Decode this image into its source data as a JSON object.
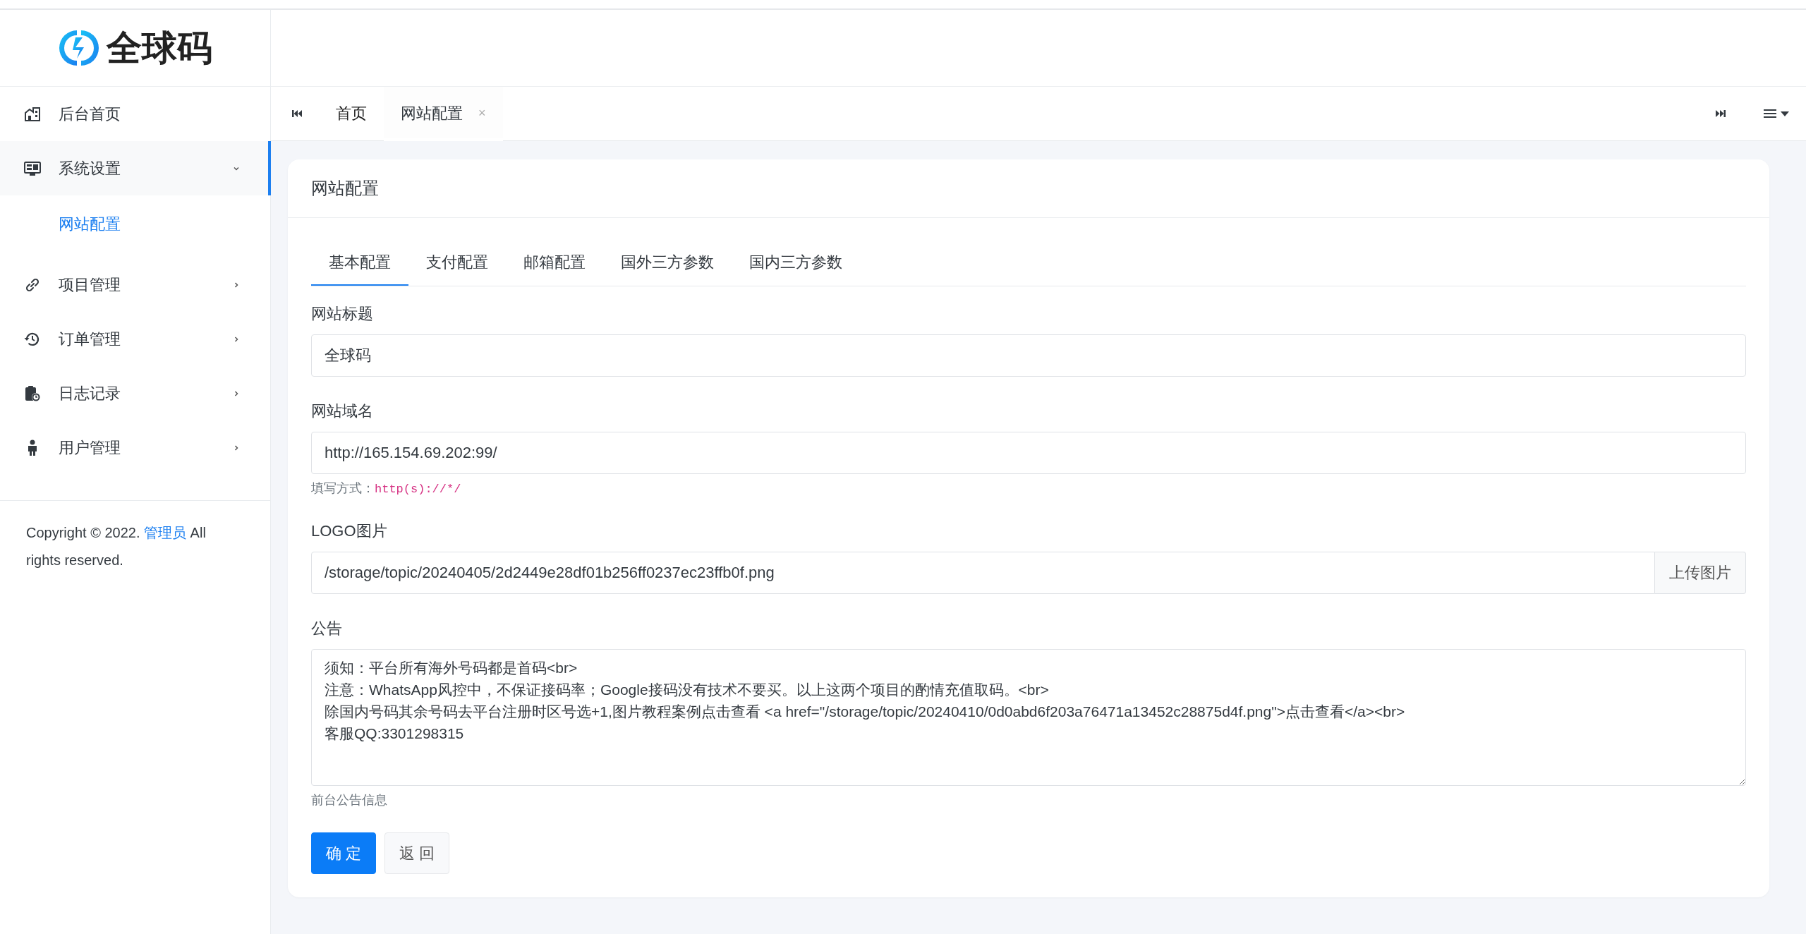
{
  "logo": {
    "text": "全球码"
  },
  "sidebar": {
    "items": [
      {
        "label": "后台首页",
        "kind": "link"
      },
      {
        "label": "系统设置",
        "kind": "group",
        "expanded": true,
        "selected": true,
        "children": [
          {
            "label": "网站配置",
            "selected": true
          }
        ]
      },
      {
        "label": "项目管理",
        "kind": "group",
        "expanded": false,
        "selected": false
      },
      {
        "label": "订单管理",
        "kind": "group",
        "expanded": false,
        "selected": false
      },
      {
        "label": "日志记录",
        "kind": "group",
        "expanded": false,
        "selected": false
      },
      {
        "label": "用户管理",
        "kind": "group",
        "expanded": false,
        "selected": false
      }
    ],
    "footer": {
      "before": "Copyright © 2022.",
      "link": "管理员",
      "after": "All rights reserved."
    }
  },
  "page_tabs": [
    {
      "label": "首页",
      "selected": false,
      "closable": false
    },
    {
      "label": "网站配置",
      "selected": true,
      "closable": true,
      "close": "×"
    }
  ],
  "card": {
    "title": "网站配置",
    "tabs": [
      {
        "label": "基本配置",
        "selected": true
      },
      {
        "label": "支付配置",
        "selected": false
      },
      {
        "label": "邮箱配置",
        "selected": false
      },
      {
        "label": "国外三方参数",
        "selected": false
      },
      {
        "label": "国内三方参数",
        "selected": false
      }
    ],
    "fields": [
      {
        "kind": "text",
        "label": "网站标题",
        "value": "全球码"
      },
      {
        "kind": "text",
        "label": "网站域名",
        "value": "http://165.154.69.202:99/",
        "help": {
          "text": "填写方式：",
          "code": "http(s)://*/"
        }
      },
      {
        "kind": "upload",
        "label": "LOGO图片",
        "value": "/storage/topic/20240405/2d2449e28df01b256ff0237ec23ffb0f.png",
        "button": "上传图片"
      },
      {
        "kind": "textarea",
        "label": "公告",
        "value": "须知：平台所有海外号码都是首码<br>\n注意：WhatsApp风控中，不保证接码率；Google接码没有技术不要买。以上这两个项目的酌情充值取码。<br>\n除国内号码其余号码去平台注册时区号选+1,图片教程案例点击查看 <a href=\"/storage/topic/20240410/0d0abd6f203a76471a13452c28875d4f.png\">点击查看</a><br>\n客服QQ:3301298315",
        "help": {
          "text": "前台公告信息"
        }
      }
    ],
    "buttons": [
      {
        "label": "确 定",
        "kind": "primary"
      },
      {
        "label": "返 回",
        "kind": "secondary"
      }
    ]
  }
}
